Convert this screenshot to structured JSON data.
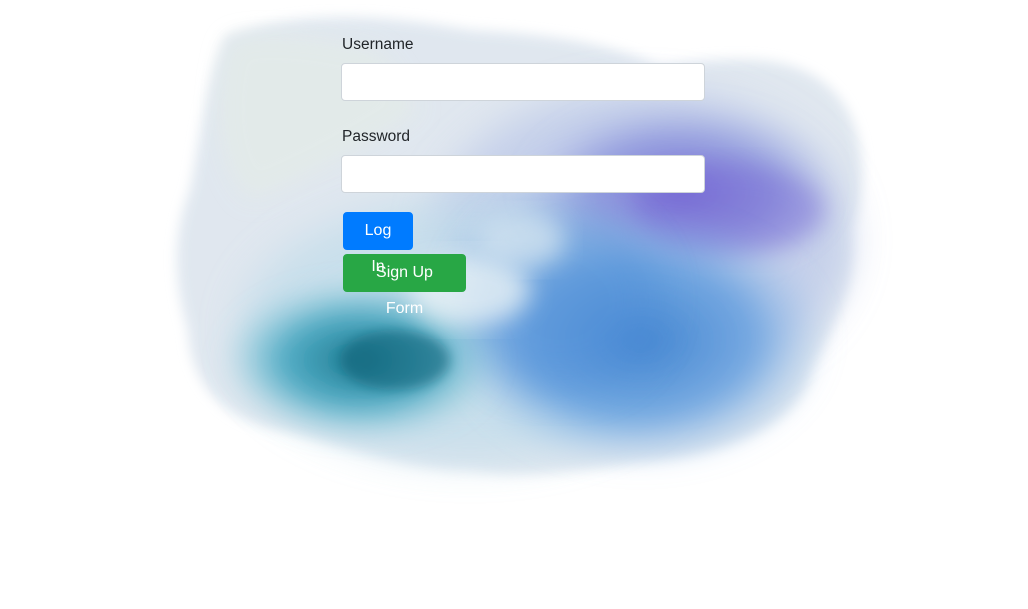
{
  "form": {
    "username_label": "Username",
    "username_value": "",
    "password_label": "Password",
    "password_value": "",
    "login_label": "Log In",
    "signup_label": "Sign Up Form"
  },
  "colors": {
    "primary_button": "#007bff",
    "success_button": "#28a745",
    "watercolor_teal": "#1e8fa8",
    "watercolor_blue": "#3f86d3",
    "watercolor_violet": "#7a67d6"
  },
  "decor": {
    "background": "watercolor-splash"
  }
}
